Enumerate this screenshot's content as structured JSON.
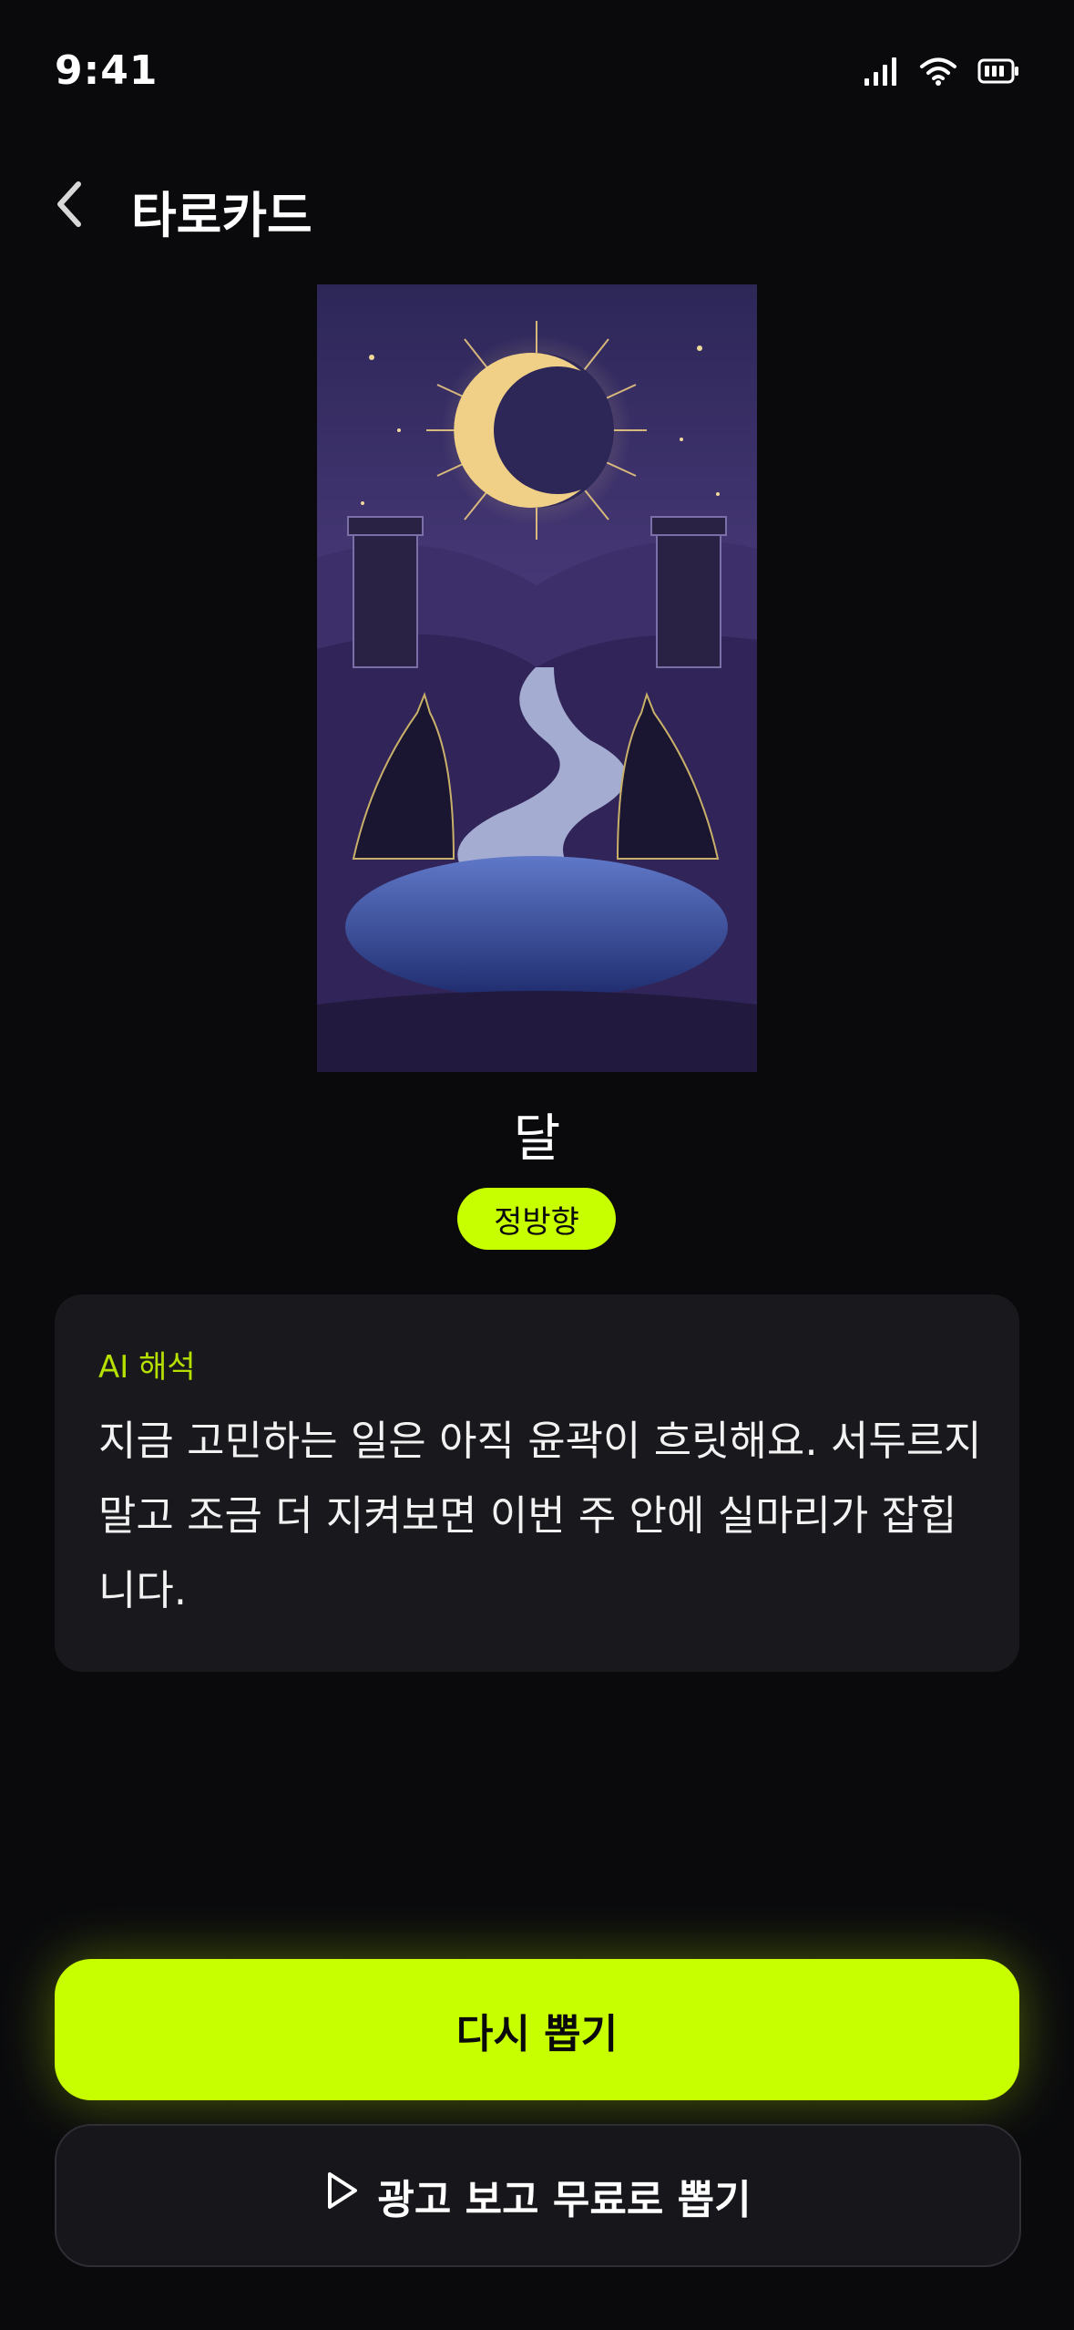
{
  "status_bar": {
    "time": "9:41",
    "icons": [
      "signal-icon",
      "wifi-icon",
      "battery-icon"
    ]
  },
  "header": {
    "title": "타로카드",
    "back_icon": "chevron-left-icon"
  },
  "card": {
    "name": "달",
    "orientation": "정방향",
    "image_desc": "moon-tarot-illustration"
  },
  "interpretation": {
    "label": "AI 해석",
    "text": "지금 고민하는 일은 아직 윤곽이 흐릿해요. 서두르지 말고 조금 더 지켜보면 이번 주 안에 실마리가 잡힙니다."
  },
  "actions": {
    "redraw_label": "다시 뽑기",
    "ad_draw_label": "광고 보고 무료로 뽑기",
    "ad_icon": "play-icon"
  },
  "colors": {
    "background": "#0a0a0d",
    "accent": "#c8ff00",
    "panel": "#18181d"
  }
}
